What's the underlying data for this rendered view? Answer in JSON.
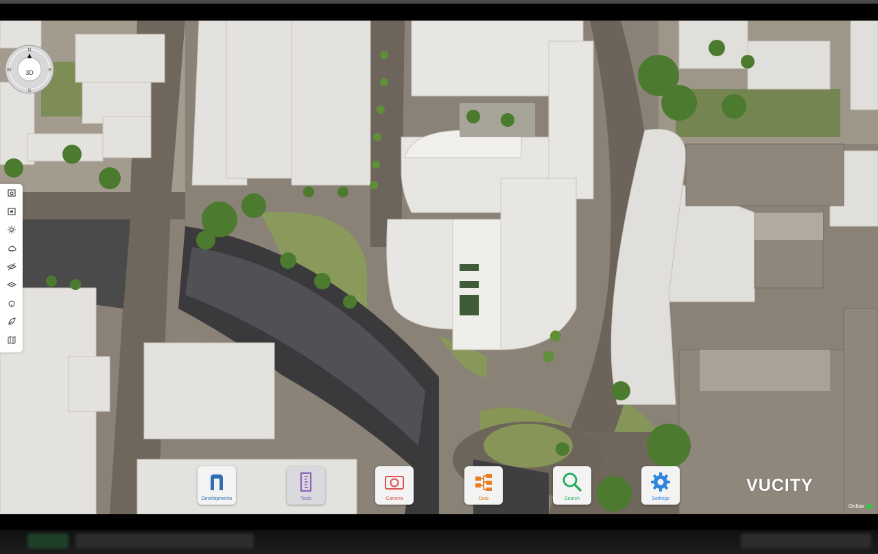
{
  "compass": {
    "mode_label": "3D",
    "north": "N",
    "east": "E",
    "south": "S",
    "west": "W"
  },
  "left_toolbar": {
    "tools": [
      {
        "icon": "camera-capture-icon"
      },
      {
        "icon": "video-record-icon"
      },
      {
        "icon": "sun-icon"
      },
      {
        "icon": "weather-cloud-icon"
      },
      {
        "icon": "hide-layer-icon"
      },
      {
        "icon": "layers-icon"
      },
      {
        "icon": "tree-icon"
      },
      {
        "icon": "leaf-icon"
      },
      {
        "icon": "map-book-icon"
      }
    ]
  },
  "dock": {
    "buttons": [
      {
        "label": "Developments",
        "color": "#2f6eb5",
        "icon": "developments-icon"
      },
      {
        "label": "Tools",
        "color": "#8e63b8",
        "icon": "tools-ruler-icon",
        "active": true
      },
      {
        "label": "Camera",
        "color": "#d9534f",
        "icon": "camera-icon"
      },
      {
        "label": "Data",
        "color": "#e67e22",
        "icon": "data-icon"
      },
      {
        "label": "Search",
        "color": "#27ae60",
        "icon": "search-icon"
      },
      {
        "label": "Settings",
        "color": "#2e86de",
        "icon": "gear-icon"
      }
    ]
  },
  "brand": {
    "logo_text": "VUCITY"
  },
  "status": {
    "text": "Online",
    "color": "#2ecc40"
  }
}
